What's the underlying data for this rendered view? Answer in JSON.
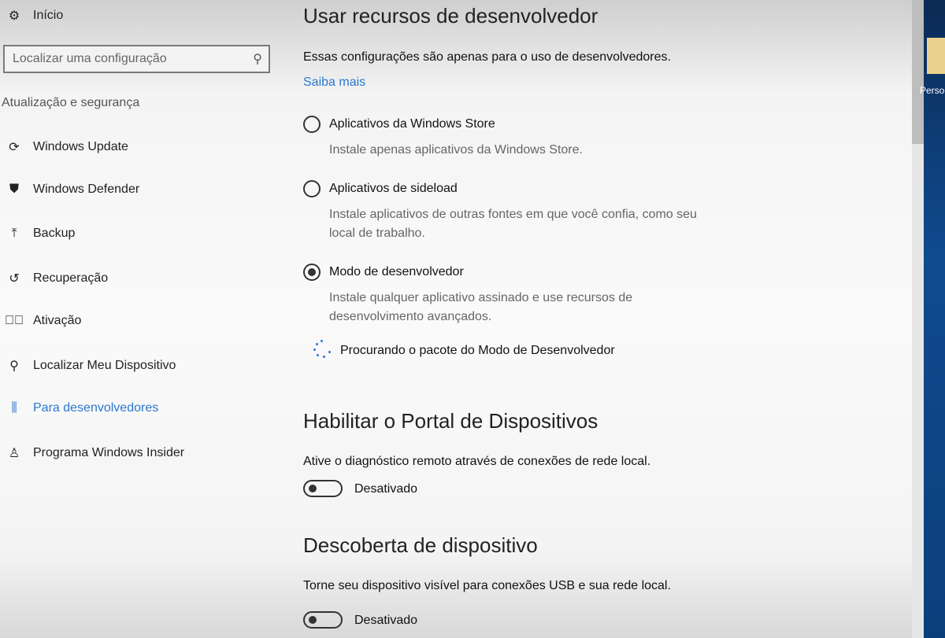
{
  "sidebar": {
    "home": "Início",
    "search_placeholder": "Localizar uma configuração",
    "group": "Atualização e segurança",
    "items": [
      {
        "label": "Windows Update",
        "icon": "sync-icon"
      },
      {
        "label": "Windows Defender",
        "icon": "shield-icon"
      },
      {
        "label": "Backup",
        "icon": "upload-icon"
      },
      {
        "label": "Recuperação",
        "icon": "history-icon"
      },
      {
        "label": "Ativação",
        "icon": "check-circle-icon"
      },
      {
        "label": "Localizar Meu Dispositivo",
        "icon": "person-pin-icon"
      },
      {
        "label": "Para desenvolvedores",
        "icon": "developer-tools-icon",
        "active": true
      },
      {
        "label": "Programa Windows Insider",
        "icon": "insider-icon"
      }
    ]
  },
  "main": {
    "title": "Usar recursos de desenvolvedor",
    "intro": "Essas configurações são apenas para o uso de desenvolvedores.",
    "learn_more": "Saiba mais",
    "options": [
      {
        "label": "Aplicativos da Windows Store",
        "desc": "Instale apenas aplicativos da Windows Store.",
        "selected": false
      },
      {
        "label": "Aplicativos de sideload",
        "desc": "Instale aplicativos de outras fontes em que você confia, como seu local de trabalho.",
        "selected": false
      },
      {
        "label": "Modo de desenvolvedor",
        "desc": "Instale qualquer aplicativo assinado e use recursos de desenvolvimento avançados.",
        "selected": true
      }
    ],
    "status": "Procurando o pacote do Modo de Desenvolvedor",
    "portal": {
      "title": "Habilitar o Portal de Dispositivos",
      "desc": "Ative o diagnóstico remoto através de conexões de rede local.",
      "toggle": "Desativado",
      "on": false
    },
    "discovery": {
      "title": "Descoberta de dispositivo",
      "desc": "Torne seu dispositivo visível para conexões USB e sua rede local.",
      "toggle": "Desativado",
      "on": false
    }
  },
  "desktop": {
    "icon_label": "Perso"
  },
  "colors": {
    "accent": "#2a78d0",
    "desktop": "#0f4b8f"
  }
}
